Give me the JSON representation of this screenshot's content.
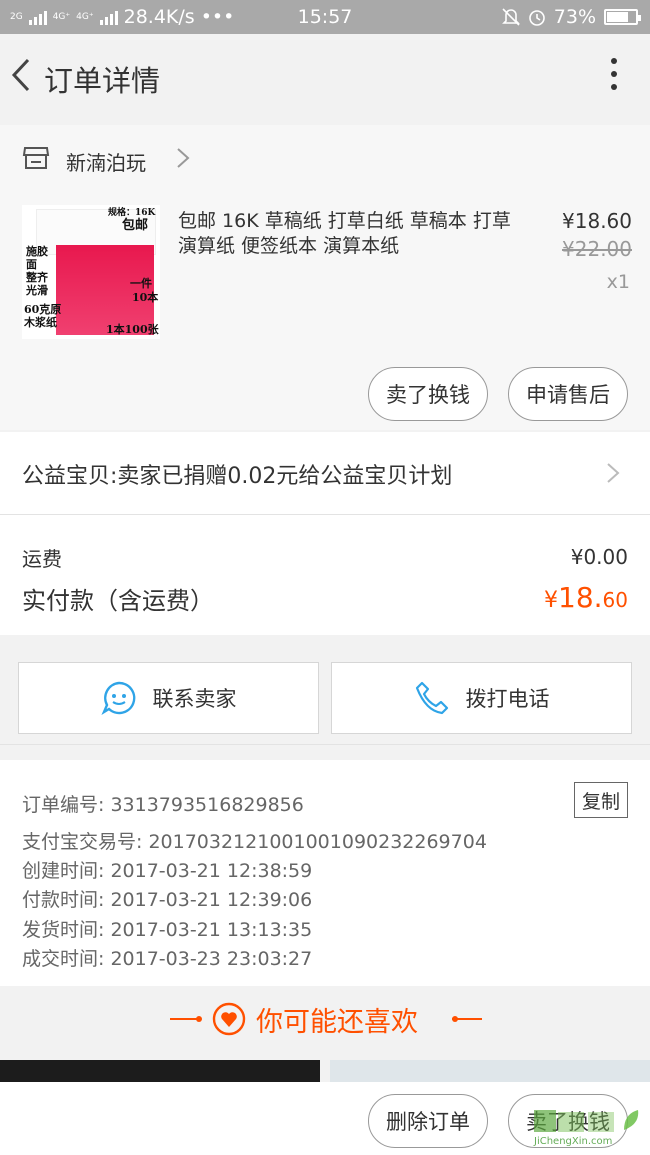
{
  "status_bar": {
    "net_speed": "28.4K/s",
    "dots": "•••",
    "time": "15:57",
    "battery": "73%",
    "signal_labels": [
      "2G",
      "4G⁺",
      "4G⁺",
      "2G"
    ]
  },
  "header": {
    "title": "订单详情"
  },
  "shop": {
    "name": "新湳泊玩"
  },
  "product": {
    "title": "包邮 16K 草稿纸 打草白纸 草稿本 打草演算纸 便签纸本 演算本纸",
    "price": "¥18.60",
    "original_price": "¥22.00",
    "quantity": "x1",
    "image_text": {
      "spec": "规格：16K",
      "free_ship": "包邮",
      "left1": "施胶",
      "left2": "面",
      "left3": "整齐",
      "left4": "光滑",
      "left5": "60克原",
      "left6": "木浆纸",
      "right1": "一件",
      "right2": "10本",
      "bottom": "1本100张"
    },
    "sell_button": "卖了换钱",
    "after_sale_button": "申请售后"
  },
  "charity": {
    "text": "公益宝贝:卖家已捐赠0.02元给公益宝贝计划"
  },
  "fees": {
    "shipping_label": "运费",
    "shipping_value": "¥0.00",
    "paid_label": "实付款（含运费）",
    "paid_currency": "¥",
    "paid_int": "18.",
    "paid_dec": "60"
  },
  "contact": {
    "seller_label": "联系卖家",
    "phone_label": "拨打电话"
  },
  "order_info": {
    "order_no": "订单编号: 3313793516829856",
    "copy_label": "复制",
    "alipay_no": "支付宝交易号: 2017032121001001090232269704",
    "created": "创建时间: 2017-03-21 12:38:59",
    "paid": "付款时间: 2017-03-21 12:39:06",
    "shipped": "发货时间: 2017-03-21 13:13:35",
    "completed": "成交时间: 2017-03-23 23:03:27"
  },
  "recommend": {
    "title": "你可能还喜欢"
  },
  "bottom_bar": {
    "delete_label": "删除订单",
    "sell_label": "卖了换钱"
  },
  "watermark": {
    "text": "JiChengXin.com"
  },
  "colors": {
    "accent": "#ff5000",
    "status_bar": "#a9a9a9",
    "contact_icon": "#2fa4e7"
  }
}
